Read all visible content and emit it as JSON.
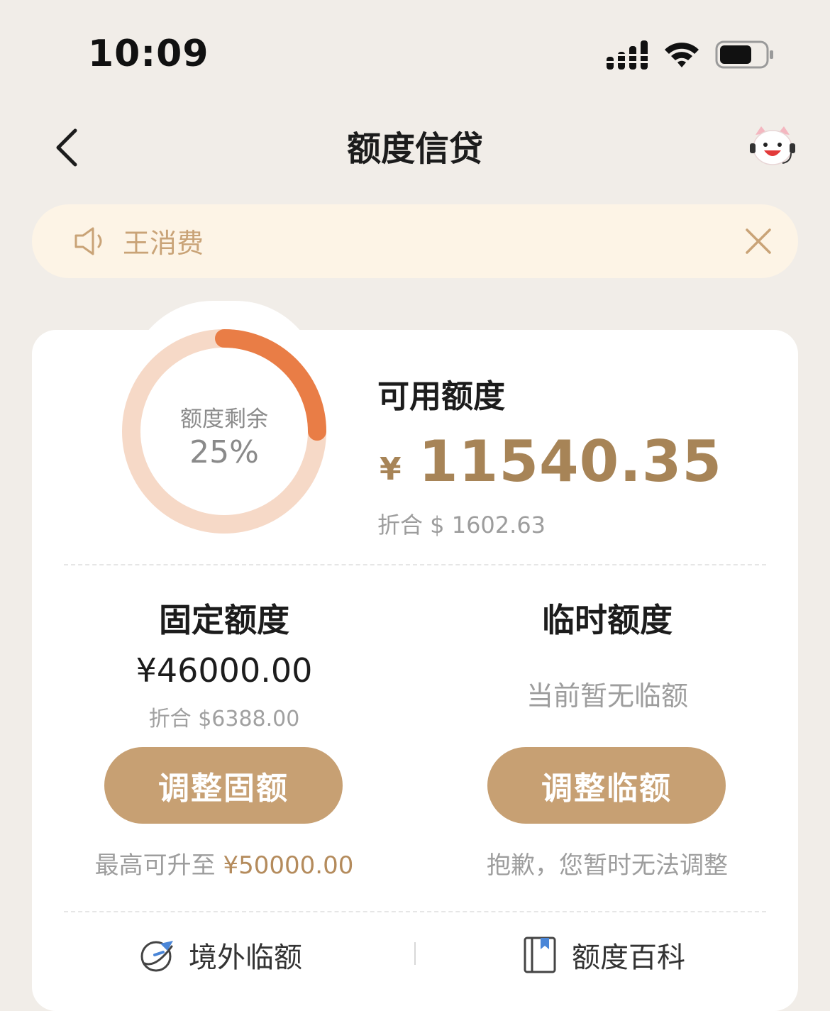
{
  "status_bar": {
    "time": "10:09"
  },
  "nav": {
    "title": "额度信贷"
  },
  "notice": {
    "text": "王消费"
  },
  "credit": {
    "ring_label": "额度剩余",
    "ring_percent": "25%",
    "ring_fraction": 0.25,
    "available_title": "可用额度",
    "currency_symbol": "¥",
    "available_amount": "11540.35",
    "available_usd": "折合 $ 1602.63"
  },
  "fixed": {
    "title": "固定额度",
    "amount": "¥46000.00",
    "usd": "折合 $6388.00",
    "button": "调整固额",
    "tip_prefix": "最高可升至 ",
    "tip_value": "¥50000.00"
  },
  "temporary": {
    "title": "临时额度",
    "status": "当前暂无临额",
    "button": "调整临额",
    "tip": "抱歉，您暂时无法调整"
  },
  "footer": {
    "overseas": "境外临额",
    "wiki": "额度百科"
  },
  "colors": {
    "accent": "#c7a073",
    "amount": "#a78457",
    "ring_progress": "#e97d46",
    "ring_track": "#f6d9c7"
  }
}
